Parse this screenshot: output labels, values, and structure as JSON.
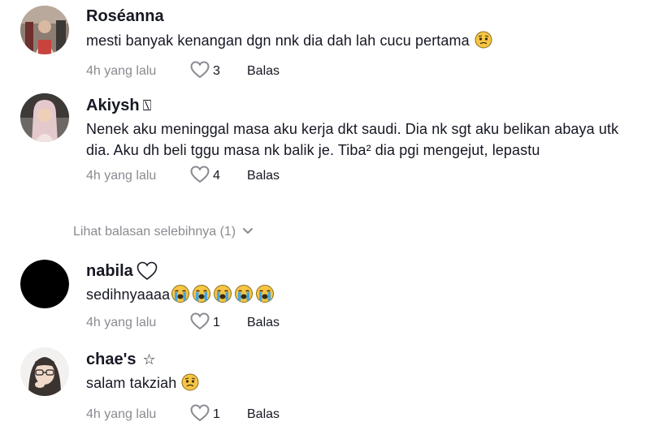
{
  "comments": [
    {
      "username": "Roséanna",
      "text": "mesti banyak kenangan dgn nnk dia dah lah cucu pertama",
      "time": "4h yang lalu",
      "likes": "3",
      "reply": "Balas",
      "trailing_emoji": "pleading-face"
    },
    {
      "username": "Akiysh",
      "username_suffix": "⍂",
      "text": "Nenek aku meninggal masa aku kerja dkt saudi. Dia nk sgt aku belikan abaya utk dia. Aku dh beli tggu masa nk balik je. Tiba² dia pgi mengejut, lepastu",
      "time": "4h yang lalu",
      "likes": "4",
      "reply": "Balas"
    },
    {
      "username": "nabila",
      "username_icon": "heart-outline",
      "text": "sedihnyaaaa",
      "trailing_emoji": "loudly-crying-face x5",
      "time": "4h yang lalu",
      "likes": "1",
      "reply": "Balas"
    },
    {
      "username": "chae's",
      "username_suffix": "☆",
      "text": "salam takziah",
      "trailing_emoji": "pleading-face",
      "time": "4h yang lalu",
      "likes": "1",
      "reply": "Balas"
    }
  ],
  "more_replies_label": "Lihat balasan selebihnya (1)",
  "colors": {
    "text": "#161823",
    "muted": "#8a8b91",
    "emoji_yellow": "#f6c544",
    "tear_blue": "#47a6e0"
  }
}
